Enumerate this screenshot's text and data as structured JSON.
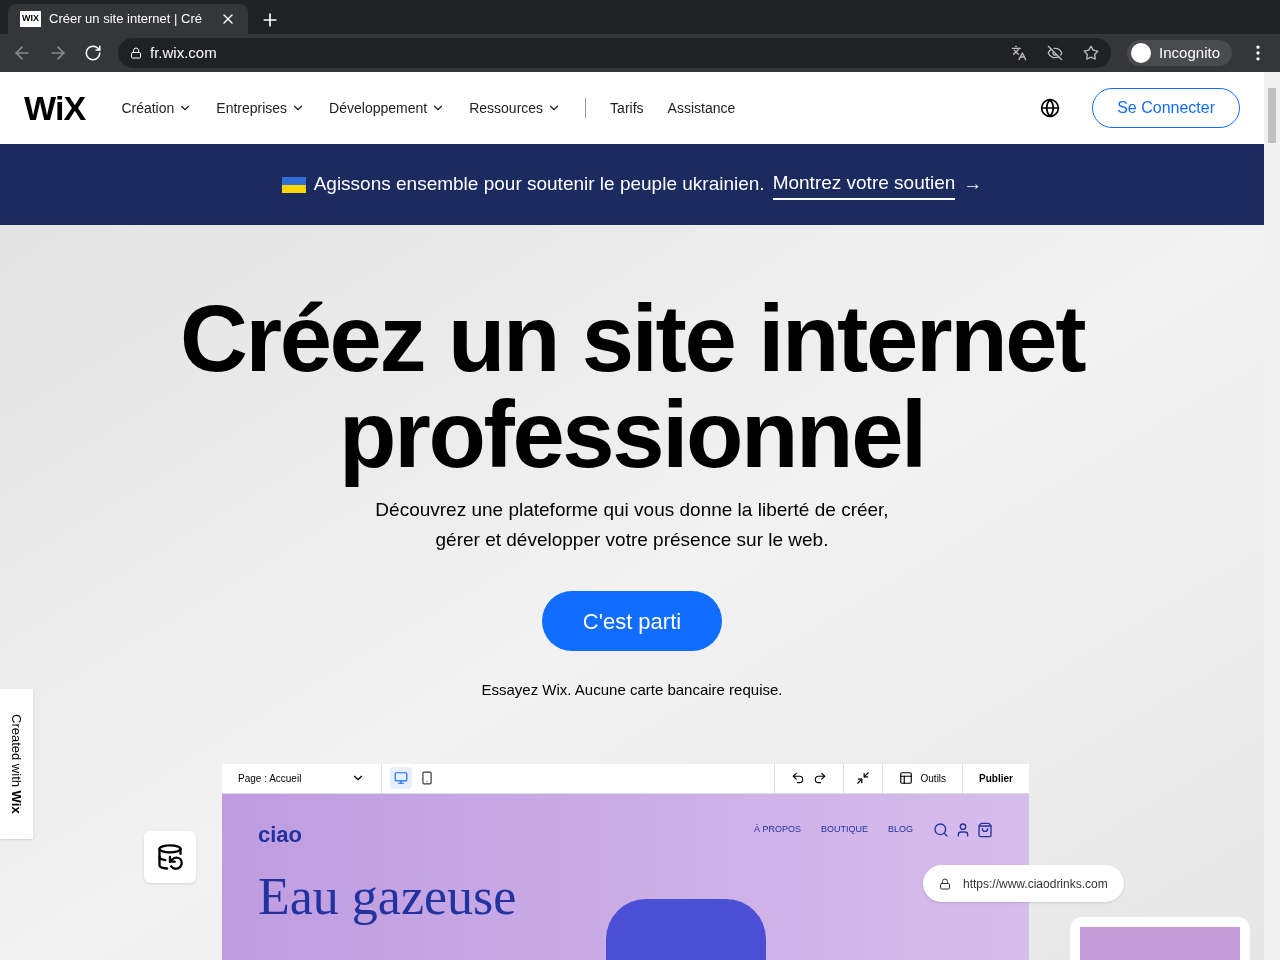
{
  "browser": {
    "favicon": "WIX",
    "tab_title": "Créer un site internet | Cré",
    "url": "fr.wix.com",
    "profile": "Incognito"
  },
  "nav": {
    "logo": "WiX",
    "items": [
      {
        "label": "Création",
        "kind": "dropdown"
      },
      {
        "label": "Entreprises",
        "kind": "dropdown"
      },
      {
        "label": "Développement",
        "kind": "dropdown"
      },
      {
        "label": "Ressources",
        "kind": "dropdown"
      },
      {
        "label": "Tarifs",
        "kind": "link"
      },
      {
        "label": "Assistance",
        "kind": "link"
      }
    ],
    "login": "Se Connecter"
  },
  "banner": {
    "text": "Agissons ensemble pour soutenir le peuple ukrainien.",
    "link": "Montrez votre soutien",
    "arrow": "→"
  },
  "hero": {
    "title": "Créez un site internet professionnel",
    "subtitle_lines": [
      "Découvrez une plateforme qui vous donne la liberté de créer,",
      "gérer et développer votre présence sur le web."
    ],
    "cta": "C'est parti",
    "note": "Essayez Wix. Aucune carte bancaire requise."
  },
  "side_badge": {
    "text": "Created with",
    "brand": "Wix"
  },
  "editor": {
    "page_select": "Page : Accueil",
    "views": [
      {
        "kind": "desktop",
        "selected": true
      },
      {
        "kind": "mobile",
        "selected": false
      }
    ],
    "tools": "Outils",
    "publish": "Publier",
    "site": {
      "logo": "ciao",
      "menu": [
        "À PROPOS",
        "BOUTIQUE",
        "BLOG"
      ],
      "heading": "Eau gazeuse"
    },
    "url": "https://www.ciaodrinks.com"
  }
}
